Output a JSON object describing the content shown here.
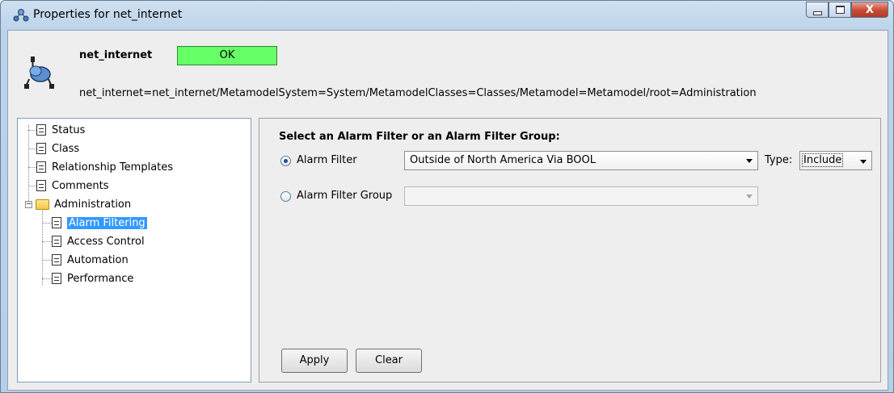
{
  "window": {
    "title": "Properties for net_internet",
    "controls": {
      "minimize": "minimize",
      "maximize": "maximize",
      "close": "X"
    }
  },
  "header": {
    "object_name": "net_internet",
    "status": "OK",
    "status_color": "#66ff66",
    "path": "net_internet=net_internet/MetamodelSystem=System/MetamodelClasses=Classes/Metamodel=Metamodel/root=Administration"
  },
  "tree": {
    "items": [
      {
        "label": "Status",
        "type": "document"
      },
      {
        "label": "Class",
        "type": "document"
      },
      {
        "label": "Relationship Templates",
        "type": "document"
      },
      {
        "label": "Comments",
        "type": "document"
      },
      {
        "label": "Administration",
        "type": "folder",
        "expanded": true
      },
      {
        "label": "Alarm Filtering",
        "type": "document",
        "selected": true
      },
      {
        "label": "Access Control",
        "type": "document"
      },
      {
        "label": "Automation",
        "type": "document"
      },
      {
        "label": "Performance",
        "type": "document"
      }
    ]
  },
  "content": {
    "section_title": "Select an Alarm Filter or an Alarm Filter Group:",
    "alarm_filter": {
      "label": "Alarm Filter",
      "selected": true,
      "value": "Outside of North America Via BOOL"
    },
    "type": {
      "label": "Type:",
      "value": "Include"
    },
    "alarm_filter_group": {
      "label": "Alarm Filter Group",
      "selected": false,
      "value": ""
    },
    "buttons": {
      "apply": "Apply",
      "clear": "Clear"
    }
  },
  "colors": {
    "selection": "#3399ff",
    "status_ok": "#66ff66"
  }
}
